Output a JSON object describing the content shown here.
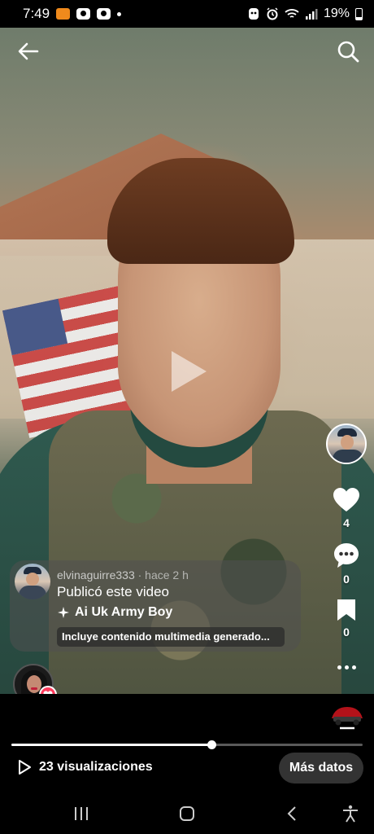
{
  "status_bar": {
    "time": "7:49",
    "battery": "19%",
    "app_icons": [
      "orange-app-icon",
      "video-icon",
      "video-icon"
    ],
    "system_icons": [
      "ghost-icon",
      "alarm-icon",
      "wifi-icon",
      "signal-icon",
      "battery-icon"
    ]
  },
  "video": {
    "state": "paused",
    "icons": {
      "back": "arrow-left-icon",
      "search": "search-icon",
      "play": "play-icon"
    }
  },
  "actions": {
    "likes": "4",
    "comments": "0",
    "saves": "0"
  },
  "post": {
    "username": "elvinaguirre333",
    "time": " · hace 2 h",
    "title": "Publicó este video",
    "effect_name": "Ai Uk Army Boy",
    "ai_label": "Incluye contenido multimedia generado..."
  },
  "footer": {
    "progress_fraction": 0.57,
    "views": "23 visualizaciones",
    "more_data": "Más datos"
  },
  "colors": {
    "heart_badge": "#ff3b5c",
    "progress_track": "#5a5a5a",
    "button_bg": "#333333"
  }
}
